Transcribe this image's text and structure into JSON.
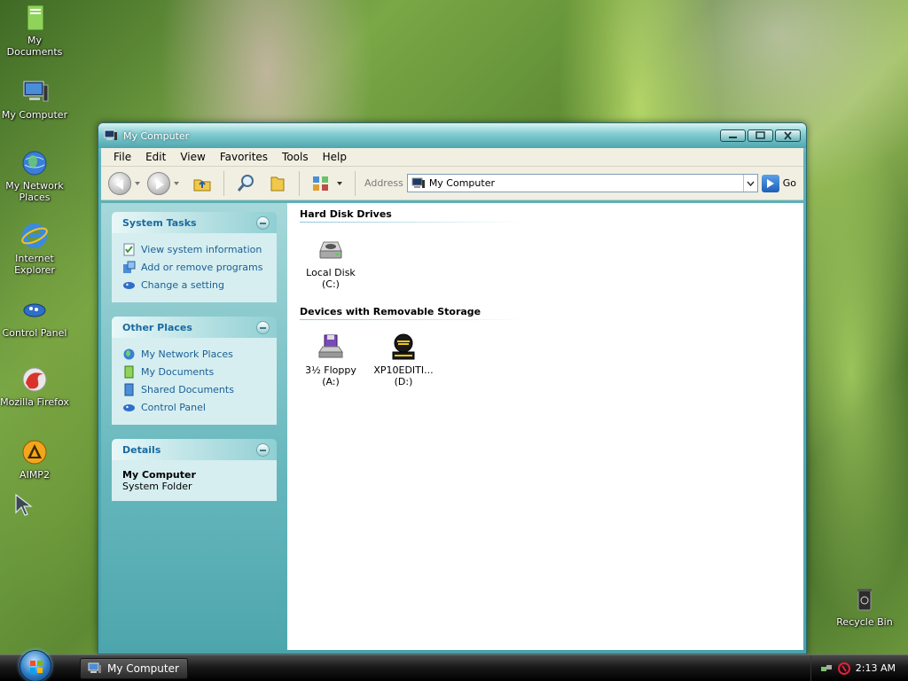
{
  "desktop": {
    "icons": [
      {
        "label": "My Documents"
      },
      {
        "label": "My Computer"
      },
      {
        "label": "My Network Places"
      },
      {
        "label": "Internet Explorer"
      },
      {
        "label": "Control Panel"
      },
      {
        "label": "Mozilla Firefox"
      },
      {
        "label": "AIMP2"
      },
      {
        "label": "Recycle Bin"
      }
    ]
  },
  "window": {
    "title": "My Computer",
    "menu": [
      "File",
      "Edit",
      "View",
      "Favorites",
      "Tools",
      "Help"
    ],
    "toolbar": {
      "address_label": "Address",
      "address_value": "My Computer",
      "go_label": "Go"
    },
    "side": {
      "system_tasks": {
        "title": "System Tasks",
        "items": [
          "View system information",
          "Add or remove programs",
          "Change a setting"
        ]
      },
      "other_places": {
        "title": "Other Places",
        "items": [
          "My Network Places",
          "My Documents",
          "Shared Documents",
          "Control Panel"
        ]
      },
      "details": {
        "title": "Details",
        "name": "My Computer",
        "type": "System Folder"
      }
    },
    "groups": {
      "hard_disk": {
        "title": "Hard Disk Drives",
        "items": [
          {
            "label": "Local Disk (C:)"
          }
        ]
      },
      "removable": {
        "title": "Devices with Removable Storage",
        "items": [
          {
            "label": "3½ Floppy",
            "sub": "(A:)"
          },
          {
            "label": "XP10EDITI...",
            "sub": "(D:)"
          }
        ]
      }
    }
  },
  "taskbar": {
    "task_button": "My Computer",
    "clock": "2:13 AM"
  }
}
